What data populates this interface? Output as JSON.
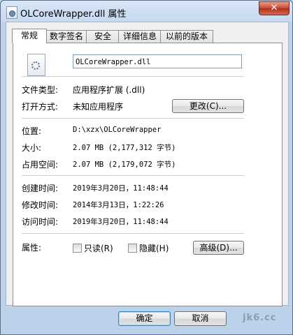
{
  "window": {
    "title": "OLCoreWrapper.dll 属性",
    "close_label": "✕"
  },
  "tabs": [
    {
      "label": "常规",
      "active": true
    },
    {
      "label": "数字签名"
    },
    {
      "label": "安全"
    },
    {
      "label": "详细信息"
    },
    {
      "label": "以前的版本"
    }
  ],
  "general": {
    "file_name": "OLCoreWrapper.dll",
    "file_type_label": "文件类型:",
    "file_type_value": "应用程序扩展 (.dll)",
    "opens_with_label": "打开方式:",
    "opens_with_value": "未知应用程序",
    "change_button": "更改(C)...",
    "location_label": "位置:",
    "location_value": "D:\\xzx\\OLCoreWrapper",
    "size_label": "大小:",
    "size_value": "2.07 MB (2,177,312 字节)",
    "size_on_disk_label": "占用空间:",
    "size_on_disk_value": "2.07 MB (2,179,072 字节)",
    "created_label": "创建时间:",
    "created_value": "2019年3月20日，11:48:44",
    "modified_label": "修改时间:",
    "modified_value": "2014年3月13日，1:22:26",
    "accessed_label": "访问时间:",
    "accessed_value": "2019年3月20日，11:48:44",
    "attributes_label": "属性:",
    "readonly_label": "只读(R)",
    "hidden_label": "隐藏(H)",
    "advanced_button": "高级(D)..."
  },
  "footer": {
    "ok": "确定",
    "cancel": "取消"
  },
  "watermark": "jk6.cc"
}
